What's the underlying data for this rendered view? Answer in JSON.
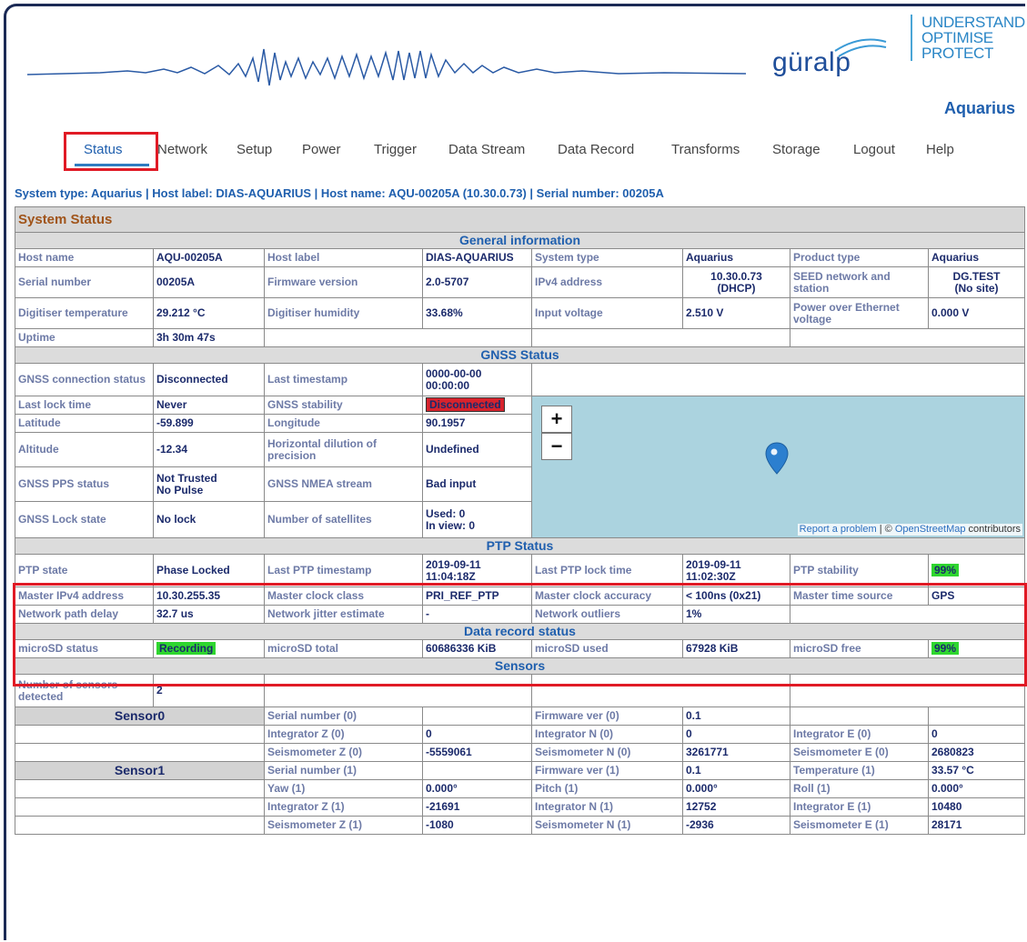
{
  "brand": {
    "wordmark": "güralp",
    "tagline": [
      "UNDERSTAND",
      "OPTIMISE",
      "PROTECT"
    ],
    "product": "Aquarius",
    "colors": {
      "brand_blue": "#1f5fae",
      "tagline_blue": "#2a86c6",
      "highlight_red": "#e01a25"
    }
  },
  "nav": {
    "items": [
      "Status",
      "Network",
      "Setup",
      "Power",
      "Trigger",
      "Data Stream",
      "Data Record",
      "Transforms",
      "Storage",
      "Logout",
      "Help"
    ],
    "active": "Status"
  },
  "sysline": "System type: Aquarius | Host label: DIAS-AQUARIUS | Host name: AQU-00205A (10.30.0.73) | Serial number: 00205A",
  "panel_title": "System Status",
  "general": {
    "title": "General information",
    "rows": [
      [
        "Host name",
        "AQU-00205A",
        "Host label",
        "DIAS-AQUARIUS",
        "System type",
        "Aquarius",
        "Product type",
        "Aquarius"
      ],
      [
        "Serial number",
        "00205A",
        "Firmware version",
        "2.0-5707",
        "IPv4 address",
        "10.30.0.73\n(DHCP)",
        "SEED network and station",
        "DG.TEST\n(No site)"
      ],
      [
        "Digitiser temperature",
        "29.212 °C",
        "Digitiser humidity",
        "33.68%",
        "Input voltage",
        "2.510 V",
        "Power over Ethernet voltage",
        "0.000 V"
      ],
      [
        "Uptime",
        "3h 30m 47s",
        "",
        "",
        "",
        "",
        "",
        ""
      ]
    ]
  },
  "gnss": {
    "title": "GNSS Status",
    "rows": [
      [
        "GNSS connection status",
        "Disconnected",
        "Last timestamp",
        "0000-00-00\n00:00:00"
      ],
      [
        "Last lock time",
        "Never",
        "GNSS stability",
        "Disconnected"
      ],
      [
        "Latitude",
        "-59.899",
        "Longitude",
        "90.1957"
      ],
      [
        "Altitude",
        "-12.34",
        "Horizontal dilution of precision",
        "Undefined"
      ],
      [
        "GNSS PPS status",
        "Not Trusted\nNo Pulse",
        "GNSS NMEA stream",
        "Bad input"
      ],
      [
        "GNSS Lock state",
        "No lock",
        "Number of satellites",
        "Used: 0\nIn view: 0"
      ]
    ],
    "map": {
      "zoom_in": "+",
      "zoom_out": "−",
      "report": "Report a problem",
      "sep": " | © ",
      "osm": "OpenStreetMap",
      "contributors": " contributors"
    }
  },
  "ptp": {
    "title": "PTP Status",
    "rows": [
      [
        "PTP state",
        "Phase Locked",
        "Last PTP timestamp",
        "2019-09-11\n11:04:18Z",
        "Last PTP lock time",
        "2019-09-11\n11:02:30Z",
        "PTP stability",
        "99%"
      ],
      [
        "Master IPv4 address",
        "10.30.255.35",
        "Master clock class",
        "PRI_REF_PTP",
        "Master clock accuracy",
        "< 100ns (0x21)",
        "Master time source",
        "GPS"
      ],
      [
        "Network path delay",
        "32.7 us",
        "Network jitter estimate",
        "-",
        "Network outliers",
        "1%",
        "",
        ""
      ]
    ]
  },
  "datarecord": {
    "title": "Data record status",
    "row": [
      "microSD status",
      "Recording",
      "microSD total",
      "60686336 KiB",
      "microSD used",
      "67928 KiB",
      "microSD free",
      "99%"
    ]
  },
  "sensors": {
    "title": "Sensors",
    "detected_label": "Number of sensors detected",
    "detected_value": "2",
    "sensor0": {
      "name": "Sensor0",
      "rows": [
        [
          "Serial number (0)",
          "",
          "Firmware ver (0)",
          "0.1",
          "",
          ""
        ],
        [
          "Integrator Z (0)",
          "0",
          "Integrator N (0)",
          "0",
          "Integrator E (0)",
          "0"
        ],
        [
          "Seismometer Z (0)",
          "-5559061",
          "Seismometer N (0)",
          "3261771",
          "Seismometer E (0)",
          "2680823"
        ]
      ]
    },
    "sensor1": {
      "name": "Sensor1",
      "rows": [
        [
          "Serial number (1)",
          "",
          "Firmware ver (1)",
          "0.1",
          "Temperature (1)",
          "33.57 °C"
        ],
        [
          "Yaw (1)",
          "0.000°",
          "Pitch (1)",
          "0.000°",
          "Roll (1)",
          "0.000°"
        ],
        [
          "Integrator Z (1)",
          "-21691",
          "Integrator N (1)",
          "12752",
          "Integrator E (1)",
          "10480"
        ],
        [
          "Seismometer Z (1)",
          "-1080",
          "Seismometer N (1)",
          "-2936",
          "Seismometer E (1)",
          "28171"
        ]
      ]
    }
  }
}
